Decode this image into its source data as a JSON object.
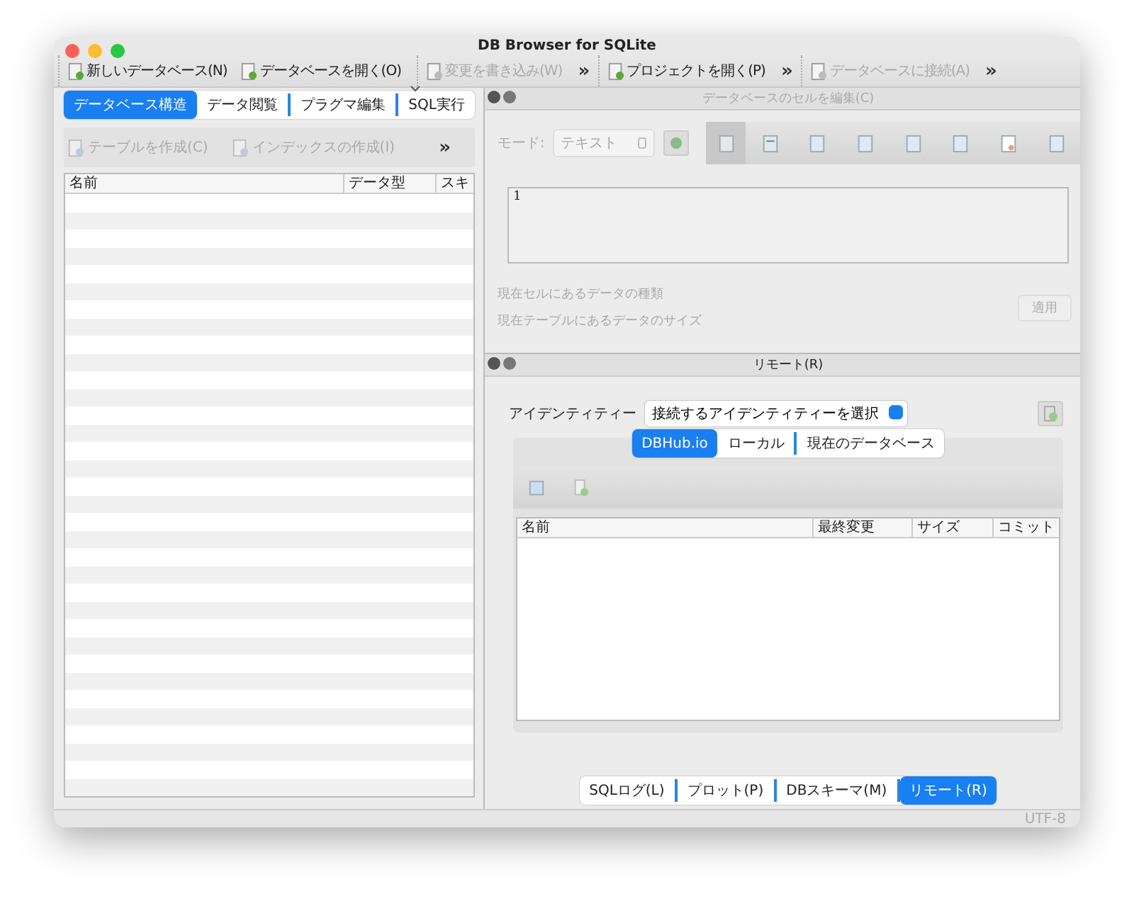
{
  "window": {
    "title": "DB Browser for SQLite"
  },
  "toolbar": [
    {
      "items": [
        {
          "label": "新しいデータベース(N)",
          "disabled": false,
          "has_menu": false
        },
        {
          "label": "データベースを開く(O)",
          "disabled": false,
          "has_menu": true
        }
      ]
    },
    {
      "items": [
        {
          "label": "変更を書き込み(W)",
          "disabled": true,
          "has_menu": false
        }
      ],
      "overflow": "»"
    },
    {
      "items": [
        {
          "label": "プロジェクトを開く(P)",
          "disabled": false,
          "has_menu": false
        }
      ],
      "overflow": "»"
    },
    {
      "items": [
        {
          "label": "データベースに接続(A)",
          "disabled": true,
          "has_menu": false
        }
      ],
      "overflow": "»"
    }
  ],
  "left": {
    "tabs": [
      {
        "label": "データベース構造",
        "selected": true
      },
      {
        "label": "データ閲覧",
        "selected": false
      },
      {
        "label": "プラグマ編集",
        "selected": false
      },
      {
        "label": "SQL実行",
        "selected": false
      }
    ],
    "actions": [
      {
        "label": "テーブルを作成(C)",
        "disabled": true
      },
      {
        "label": "インデックスの作成(I)",
        "disabled": true
      }
    ],
    "actions_overflow": "»",
    "columns": [
      "名前",
      "データ型",
      "スキ"
    ]
  },
  "edit_cell": {
    "title": "データベースのセルを編集(C)",
    "mode_label": "モード:",
    "mode_value": "テキスト",
    "value": "1",
    "info": [
      "現在セルにあるデータの種類",
      "現在テーブルにあるデータのサイズ"
    ],
    "apply": "適用"
  },
  "remote": {
    "title": "リモート(R)",
    "identity_label": "アイデンティティー",
    "identity_value": "接続するアイデンティティーを選択",
    "tabs": [
      {
        "label": "DBHub.io",
        "selected": true
      },
      {
        "label": "ローカル",
        "selected": false
      },
      {
        "label": "現在のデータベース",
        "selected": false
      }
    ],
    "columns": [
      "名前",
      "最終変更",
      "サイズ",
      "コミット"
    ]
  },
  "bottom_tabs": [
    {
      "label": "SQLログ(L)",
      "selected": false
    },
    {
      "label": "プロット(P)",
      "selected": false
    },
    {
      "label": "DBスキーマ(M)",
      "selected": false
    },
    {
      "label": "リモート(R)",
      "selected": true
    }
  ],
  "status_bar": {
    "encoding": "UTF-8"
  }
}
